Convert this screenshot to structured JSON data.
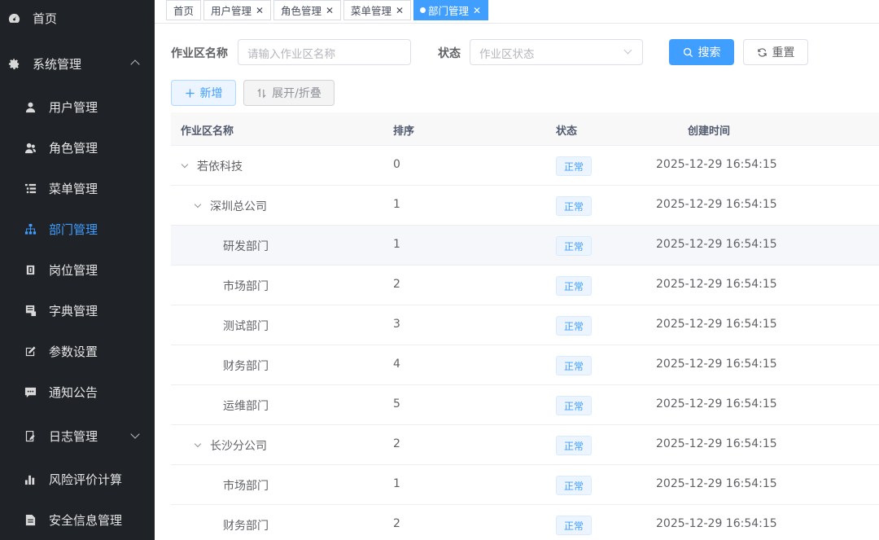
{
  "sidebar": {
    "items": [
      {
        "label": "首页",
        "icon": "dashboard-icon"
      },
      {
        "label": "系统管理",
        "icon": "gear-icon"
      },
      {
        "label": "用户管理",
        "icon": "user-icon"
      },
      {
        "label": "角色管理",
        "icon": "users-icon"
      },
      {
        "label": "菜单管理",
        "icon": "tree-table-icon"
      },
      {
        "label": "部门管理",
        "icon": "org-tree-icon"
      },
      {
        "label": "岗位管理",
        "icon": "post-icon"
      },
      {
        "label": "字典管理",
        "icon": "dict-icon"
      },
      {
        "label": "参数设置",
        "icon": "edit-icon"
      },
      {
        "label": "通知公告",
        "icon": "message-icon"
      },
      {
        "label": "日志管理",
        "icon": "log-icon"
      },
      {
        "label": "风险评价计算",
        "icon": "bar-chart-icon"
      },
      {
        "label": "安全信息管理",
        "icon": "document-icon"
      }
    ],
    "active": "部门管理"
  },
  "tags": [
    {
      "label": "首页"
    },
    {
      "label": "用户管理"
    },
    {
      "label": "角色管理"
    },
    {
      "label": "菜单管理"
    },
    {
      "label": "部门管理"
    }
  ],
  "search": {
    "name_label": "作业区名称",
    "name_placeholder": "请输入作业区名称",
    "status_label": "状态",
    "status_placeholder": "作业区状态",
    "search_button": "搜索",
    "reset_button": "重置"
  },
  "toolbar": {
    "add_button": "新增",
    "expand_button": "展开/折叠"
  },
  "table": {
    "columns": [
      "作业区名称",
      "排序",
      "状态",
      "创建时间"
    ],
    "rows": [
      {
        "name": "若依科技",
        "order": "0",
        "status": "正常",
        "created": "2025-12-29 16:54:15"
      },
      {
        "name": "深圳总公司",
        "order": "1",
        "status": "正常",
        "created": "2025-12-29 16:54:15"
      },
      {
        "name": "研发部门",
        "order": "1",
        "status": "正常",
        "created": "2025-12-29 16:54:15"
      },
      {
        "name": "市场部门",
        "order": "2",
        "status": "正常",
        "created": "2025-12-29 16:54:15"
      },
      {
        "name": "测试部门",
        "order": "3",
        "status": "正常",
        "created": "2025-12-29 16:54:15"
      },
      {
        "name": "财务部门",
        "order": "4",
        "status": "正常",
        "created": "2025-12-29 16:54:15"
      },
      {
        "name": "运维部门",
        "order": "5",
        "status": "正常",
        "created": "2025-12-29 16:54:15"
      },
      {
        "name": "长沙分公司",
        "order": "2",
        "status": "正常",
        "created": "2025-12-29 16:54:15"
      },
      {
        "name": "市场部门",
        "order": "1",
        "status": "正常",
        "created": "2025-12-29 16:54:15"
      },
      {
        "name": "财务部门",
        "order": "2",
        "status": "正常",
        "created": "2025-12-29 16:54:15"
      }
    ]
  },
  "colors": {
    "sidebar_bg": "#1f2227",
    "accent": "#409eff",
    "header_bg": "#f8f8f9"
  }
}
